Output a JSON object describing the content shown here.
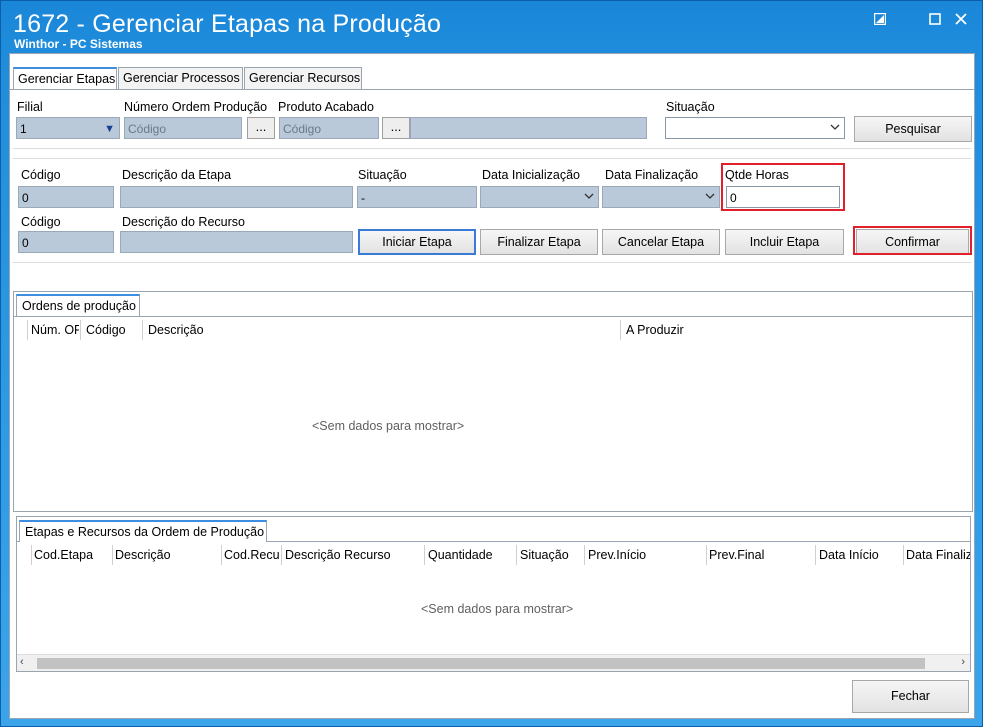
{
  "window": {
    "title": "1672 - Gerenciar Etapas na Produção",
    "subtitle": "Winthor - PC Sistemas"
  },
  "tabs": [
    "Gerenciar Etapas",
    "Gerenciar Processos",
    "Gerenciar Recursos"
  ],
  "filters": {
    "filial_label": "Filial",
    "filial_value": "1",
    "ordem_label": "Número Ordem Produção",
    "ordem_placeholder": "Código",
    "produto_label": "Produto Acabado",
    "produto_placeholder": "Código",
    "situacao_label": "Situação",
    "situacao_value": "",
    "pesquisar_label": "Pesquisar",
    "dots": "..."
  },
  "etapa": {
    "codigo_label": "Código",
    "codigo_value": "0",
    "descricao_label": "Descrição da Etapa",
    "descricao_value": "",
    "situacao_label": "Situação",
    "situacao_value": "-",
    "data_ini_label": "Data Inicialização",
    "data_fim_label": "Data Finalização",
    "qtde_label": "Qtde Horas",
    "qtde_value": "0"
  },
  "recurso": {
    "codigo_label": "Código",
    "codigo_value": "0",
    "descricao_label": "Descrição do Recurso",
    "descricao_value": ""
  },
  "actions": {
    "iniciar": "Iniciar Etapa",
    "finalizar": "Finalizar Etapa",
    "cancelar": "Cancelar Etapa",
    "incluir": "Incluir Etapa",
    "confirmar": "Confirmar",
    "fechar": "Fechar"
  },
  "ordens": {
    "tab_label": "Ordens de produção",
    "columns": [
      "Núm. OP",
      "Código",
      "Descrição",
      "A Produzir"
    ],
    "empty": "<Sem dados para mostrar>"
  },
  "etapas_recursos": {
    "tab_label": "Etapas e Recursos da Ordem de Produção",
    "columns": [
      "Cod.Etapa",
      "Descrição",
      "Cod.Recurso",
      "Descrição Recurso",
      "Quantidade",
      "Situação",
      "Prev.Início",
      "Prev.Final",
      "Data Início",
      "Data Finalização"
    ],
    "empty": "<Sem dados para mostrar>"
  },
  "colors": {
    "title_bar": "#1f8ddc",
    "field_bg": "#b9c9d9",
    "highlight": "#e0202a",
    "tab_accent": "#3d8ee0"
  }
}
